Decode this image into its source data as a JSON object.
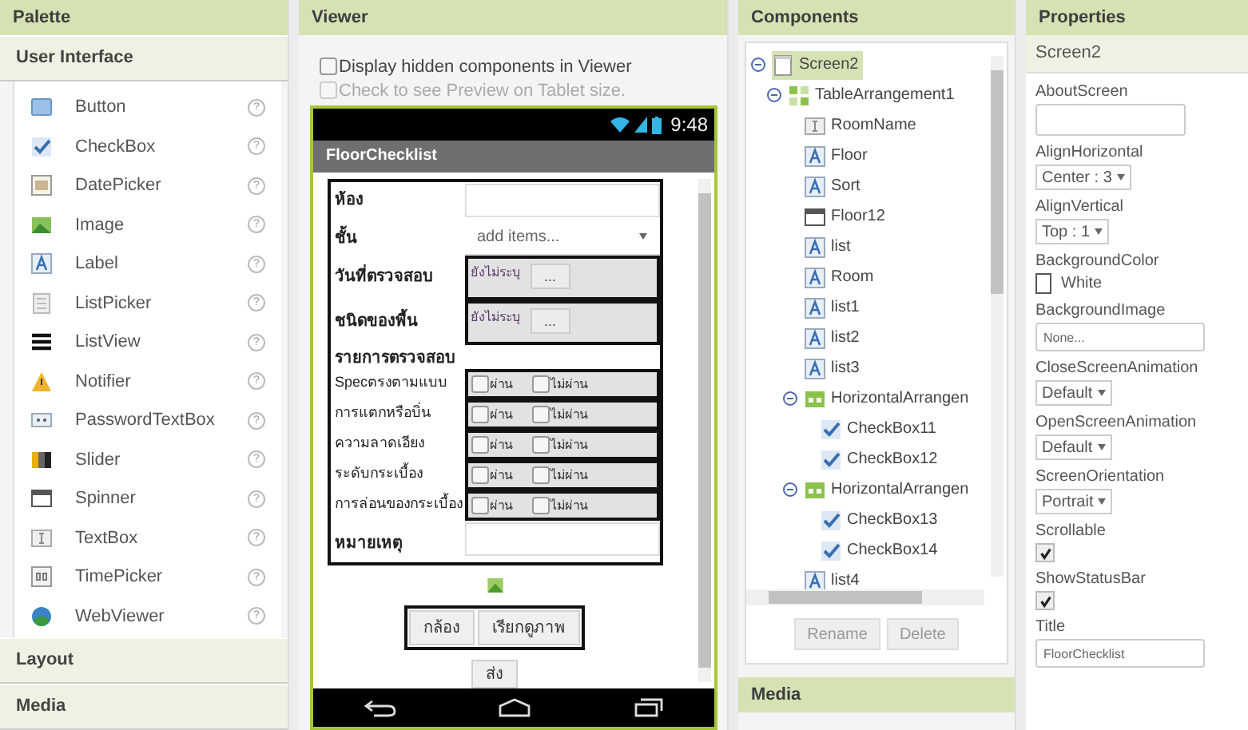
{
  "palette": {
    "title": "Palette",
    "section": "User Interface",
    "items": [
      {
        "label": "Button",
        "help": "?"
      },
      {
        "label": "CheckBox",
        "help": "?"
      },
      {
        "label": "DatePicker",
        "help": "?"
      },
      {
        "label": "Image",
        "help": "?"
      },
      {
        "label": "Label",
        "help": "?"
      },
      {
        "label": "ListPicker",
        "help": "?"
      },
      {
        "label": "ListView",
        "help": "?"
      },
      {
        "label": "Notifier",
        "help": "?"
      },
      {
        "label": "PasswordTextBox",
        "help": "?"
      },
      {
        "label": "Slider",
        "help": "?"
      },
      {
        "label": "Spinner",
        "help": "?"
      },
      {
        "label": "TextBox",
        "help": "?"
      },
      {
        "label": "TimePicker",
        "help": "?"
      },
      {
        "label": "WebViewer",
        "help": "?"
      }
    ],
    "sections": [
      "Layout",
      "Media"
    ]
  },
  "viewer": {
    "title": "Viewer",
    "options": [
      {
        "label": "Display hidden components in Viewer",
        "checked": false,
        "disabled": false
      },
      {
        "label": "Check to see Preview on Tablet size.",
        "checked": false,
        "disabled": true
      }
    ],
    "phone": {
      "time": "9:48",
      "title": "FloorChecklist",
      "rows": [
        {
          "kind": "textbox",
          "label": "ห้อง"
        },
        {
          "kind": "spinner",
          "label": "ชั้น",
          "value": "add items..."
        },
        {
          "kind": "picker",
          "label": "วันที่ตรวจสอบ",
          "value": "ยังไม่ระบุ",
          "button": "..."
        },
        {
          "kind": "picker",
          "label": "ชนิดของพื้น",
          "value": "ยังไม่ระบุ",
          "button": "..."
        },
        {
          "kind": "heading",
          "label": "รายการตรวจสอบ"
        },
        {
          "kind": "check",
          "label": "Specตรงตามแบบ",
          "options": [
            {
              "label": "ผ่าน",
              "checked": false
            },
            {
              "label": "ไม่ผ่าน",
              "checked": false
            }
          ]
        },
        {
          "kind": "check",
          "label": "การแตกหรือบิ่น",
          "options": [
            {
              "label": "ผ่าน",
              "checked": false
            },
            {
              "label": "ไม่ผ่าน",
              "checked": false
            }
          ]
        },
        {
          "kind": "check",
          "label": "ความลาดเอียง",
          "options": [
            {
              "label": "ผ่าน",
              "checked": false
            },
            {
              "label": "ไม่ผ่าน",
              "checked": false
            }
          ]
        },
        {
          "kind": "check",
          "label": "ระดับกระเบื้อง",
          "options": [
            {
              "label": "ผ่าน",
              "checked": false
            },
            {
              "label": "ไม่ผ่าน",
              "checked": false
            }
          ]
        },
        {
          "kind": "check",
          "label": "การล่อนของกระเบื้อง",
          "options": [
            {
              "label": "ผ่าน",
              "checked": false
            },
            {
              "label": "ไม่ผ่าน",
              "checked": false
            }
          ]
        },
        {
          "kind": "textbox",
          "label": "หมายเหตุ"
        }
      ],
      "buttons": [
        "กล้อง",
        "เรียกดูภาพ"
      ],
      "send": "ส่ง"
    }
  },
  "components": {
    "title": "Components",
    "tree": [
      {
        "kind": "screen",
        "label": "Screen2",
        "selected": true,
        "expanded": true,
        "children": [
          {
            "kind": "table",
            "label": "TableArrangement1",
            "selected": false,
            "expanded": true,
            "children": [
              {
                "kind": "textbox",
                "label": "RoomName",
                "selected": false
              },
              {
                "kind": "label",
                "label": "Floor",
                "selected": false
              },
              {
                "kind": "label",
                "label": "Sort",
                "selected": false
              },
              {
                "kind": "spinner",
                "label": "Floor12",
                "selected": false
              },
              {
                "kind": "label",
                "label": "list",
                "selected": false
              },
              {
                "kind": "label",
                "label": "Room",
                "selected": false
              },
              {
                "kind": "label",
                "label": "list1",
                "selected": false
              },
              {
                "kind": "label",
                "label": "list2",
                "selected": false
              },
              {
                "kind": "label",
                "label": "list3",
                "selected": false
              },
              {
                "kind": "horizontal",
                "label": "HorizontalArrangen",
                "selected": false,
                "expanded": true,
                "children": [
                  {
                    "kind": "checkbox",
                    "label": "CheckBox11",
                    "selected": false
                  },
                  {
                    "kind": "checkbox",
                    "label": "CheckBox12",
                    "selected": false
                  }
                ]
              },
              {
                "kind": "horizontal",
                "label": "HorizontalArrangen",
                "selected": false,
                "expanded": true,
                "children": [
                  {
                    "kind": "checkbox",
                    "label": "CheckBox13",
                    "selected": false
                  },
                  {
                    "kind": "checkbox",
                    "label": "CheckBox14",
                    "selected": false
                  }
                ]
              },
              {
                "kind": "label",
                "label": "list4",
                "selected": false
              }
            ]
          }
        ]
      }
    ],
    "buttons": [
      "Rename",
      "Delete"
    ],
    "media": "Media"
  },
  "properties": {
    "title": "Properties",
    "component": "Screen2",
    "items": [
      {
        "kind": "textarea",
        "label": "AboutScreen"
      },
      {
        "kind": "dropdown",
        "label": "AlignHorizontal",
        "value": "Center : 3"
      },
      {
        "kind": "dropdown",
        "label": "AlignVertical",
        "value": "Top : 1"
      },
      {
        "kind": "color",
        "label": "BackgroundColor",
        "value": "White"
      },
      {
        "kind": "field",
        "label": "BackgroundImage",
        "value": "None..."
      },
      {
        "kind": "dropdown",
        "label": "CloseScreenAnimation",
        "value": "Default"
      },
      {
        "kind": "dropdown",
        "label": "OpenScreenAnimation",
        "value": "Default"
      },
      {
        "kind": "dropdown",
        "label": "ScreenOrientation",
        "value": "Portrait"
      },
      {
        "kind": "checkbox",
        "label": "Scrollable",
        "checked": true
      },
      {
        "kind": "checkbox",
        "label": "ShowStatusBar",
        "checked": true
      },
      {
        "kind": "field",
        "label": "Title",
        "value": "FloorChecklist"
      }
    ]
  }
}
